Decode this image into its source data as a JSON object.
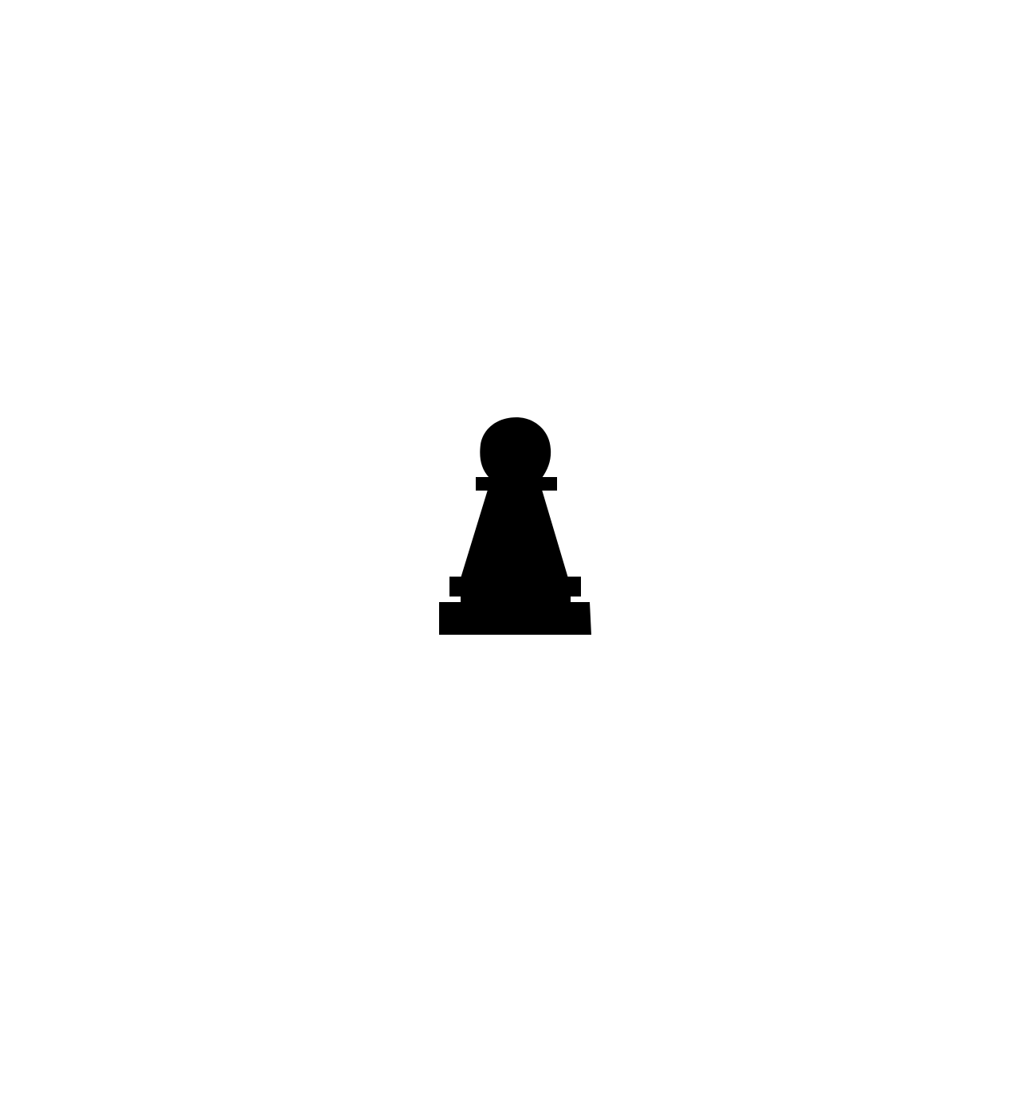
{
  "canvas": {
    "background_color": "#ffffff"
  },
  "figure": {
    "icon": "pawn-icon",
    "fill_color": "#000000"
  }
}
